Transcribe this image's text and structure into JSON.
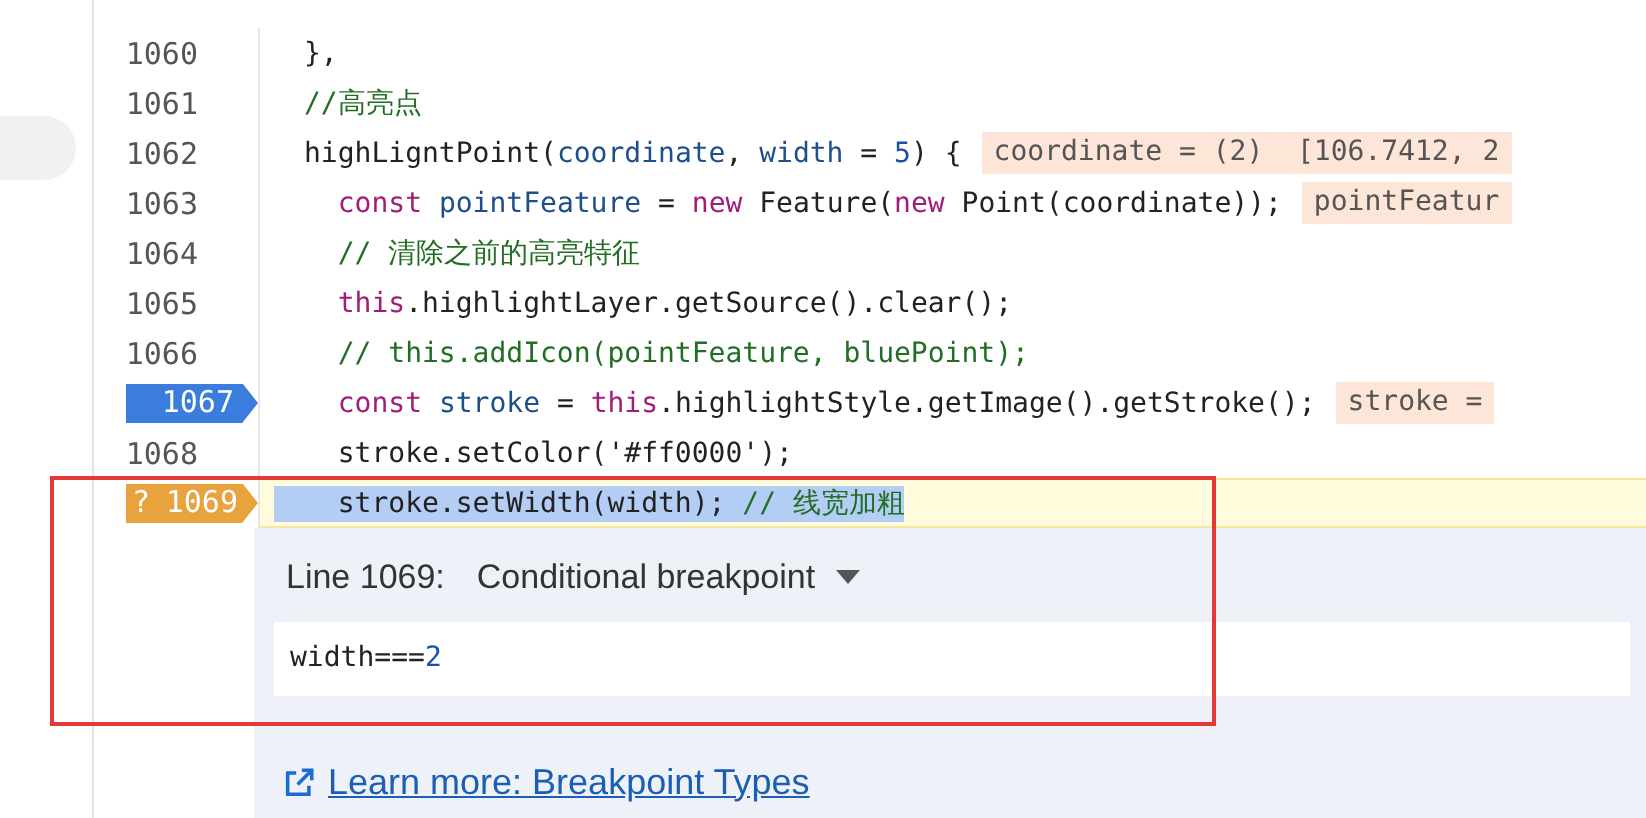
{
  "lines": [
    {
      "number": "1060",
      "tokens": [
        {
          "text": "},",
          "kind": "plain"
        }
      ]
    },
    {
      "number": "1061",
      "tokens": [
        {
          "text": "//高亮点",
          "kind": "comment"
        }
      ]
    },
    {
      "number": "1062",
      "tokens": [
        {
          "text": "highLigntPoint(",
          "kind": "plain"
        },
        {
          "text": "coordinate",
          "kind": "param"
        },
        {
          "text": ", ",
          "kind": "plain"
        },
        {
          "text": "width",
          "kind": "param"
        },
        {
          "text": " = ",
          "kind": "plain"
        },
        {
          "text": "5",
          "kind": "number"
        },
        {
          "text": ") {",
          "kind": "plain"
        }
      ],
      "inline_value": "coordinate = (2)  [106.7412, 2"
    },
    {
      "number": "1063",
      "tokens": [
        {
          "text": "  const",
          "kind": "keyword"
        },
        {
          "text": " pointFeature",
          "kind": "param"
        },
        {
          "text": " = ",
          "kind": "plain"
        },
        {
          "text": "new",
          "kind": "keyword"
        },
        {
          "text": " Feature(",
          "kind": "plain"
        },
        {
          "text": "new",
          "kind": "keyword"
        },
        {
          "text": " Point(coordinate));",
          "kind": "plain"
        }
      ],
      "inline_value": "pointFeatur"
    },
    {
      "number": "1064",
      "tokens": [
        {
          "text": "  // 清除之前的高亮特征",
          "kind": "comment"
        }
      ]
    },
    {
      "number": "1065",
      "tokens": [
        {
          "text": "  this",
          "kind": "keyword"
        },
        {
          "text": ".highlightLayer.getSource().clear();",
          "kind": "plain"
        }
      ]
    },
    {
      "number": "1066",
      "tokens": [
        {
          "text": "  // this.addIcon(pointFeature, bluePoint);",
          "kind": "comment"
        }
      ]
    },
    {
      "number": "1067",
      "breakpoint": true,
      "tokens": [
        {
          "text": "  const",
          "kind": "keyword"
        },
        {
          "text": " stroke",
          "kind": "param"
        },
        {
          "text": " = ",
          "kind": "plain"
        },
        {
          "text": "this",
          "kind": "keyword"
        },
        {
          "text": ".highlightStyle.getImage().getStroke();",
          "kind": "plain"
        }
      ],
      "inline_value": "stroke ="
    },
    {
      "number": "1068",
      "tokens": [
        {
          "text": "  stroke.setColor('#ff0000');",
          "kind": "plain"
        }
      ]
    },
    {
      "number": "1069",
      "breakpoint": true,
      "breakpoint_mark": "?",
      "highlighted": true,
      "tokens": [
        {
          "text": "  stroke.setWidth(width); ",
          "kind": "plain"
        },
        {
          "text": "// 线宽加粗",
          "kind": "comment"
        }
      ]
    }
  ],
  "breakpoint_editor": {
    "line_label": "Line 1069:",
    "type": "Conditional breakpoint",
    "condition": [
      {
        "text": "width===",
        "kind": "plain"
      },
      {
        "text": "2",
        "kind": "number"
      }
    ],
    "link": "Learn more: Breakpoint Types"
  }
}
